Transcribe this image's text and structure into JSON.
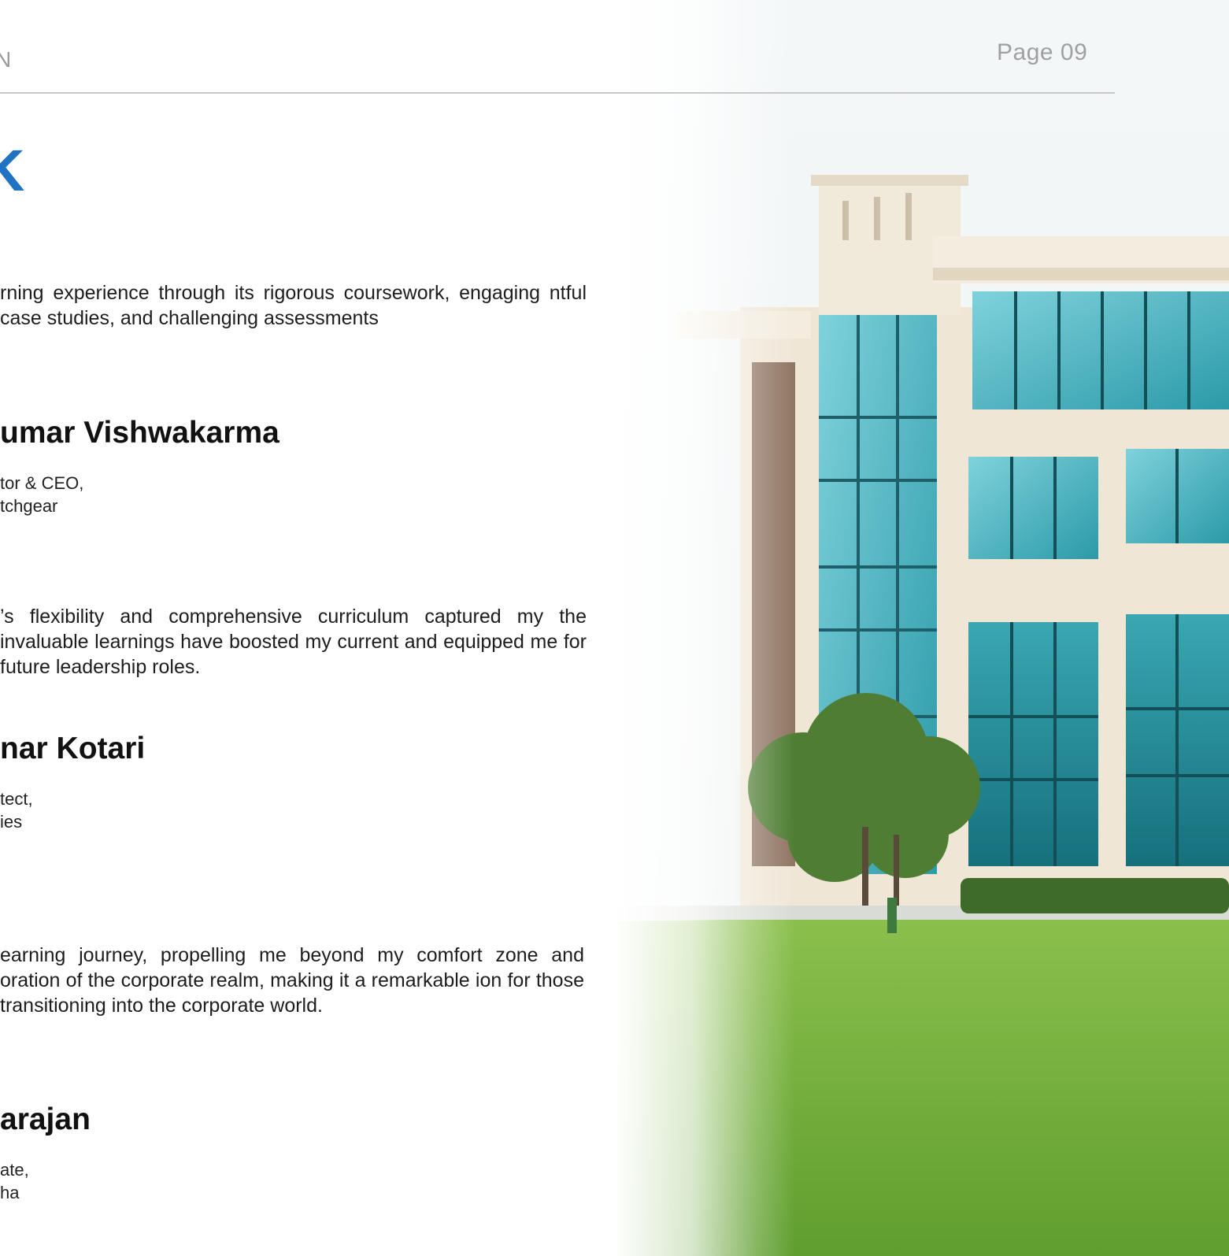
{
  "header": {
    "left_fragment": "N",
    "page_number": "Page 09"
  },
  "section_heading": "K",
  "testimonials": [
    {
      "quote": "rning experience through its rigorous coursework, engaging ntful case studies, and challenging assessments",
      "name": "umar Vishwakarma",
      "role_line1": "tor & CEO,",
      "role_line2": "tchgear"
    },
    {
      "quote": "’s flexibility and comprehensive curriculum captured my the invaluable learnings have boosted my current and equipped me for future leadership roles.",
      "name": "nar Kotari",
      "role_line1": "tect,",
      "role_line2": "ies"
    },
    {
      "quote": "earning journey, propelling me beyond my comfort zone and oration of the corporate realm, making it a remarkable ion for those transitioning into the corporate world.",
      "name": "arajan",
      "role_line1": "ate,",
      "role_line2": "ha"
    }
  ],
  "colors": {
    "accent": "#1f73c2",
    "glass": "#3fb3c0",
    "lawn": "#6fae3a",
    "facade": "#efe6d6"
  },
  "background_image": "campus-building-photo"
}
